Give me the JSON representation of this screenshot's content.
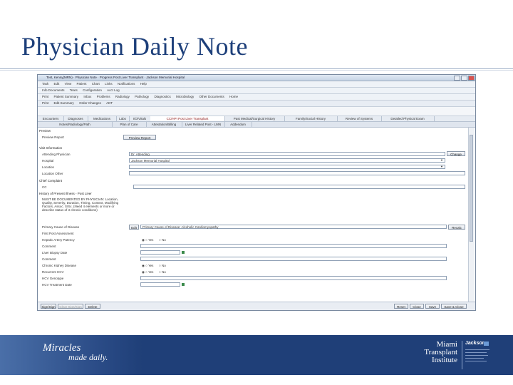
{
  "slide": {
    "title": "Physician Daily Note"
  },
  "app": {
    "window_title": "Test, Kenny(MRN) · Physician Note · Progress Post Liver Transplant · Jackson Memorial Hospital",
    "menubar": [
      "Task",
      "Edit",
      "View",
      "Patient",
      "Chart",
      "Links",
      "Notifications",
      "Help"
    ],
    "subbar": [
      "Info Documents",
      "Tears",
      "Configuration",
      "Acct Log"
    ],
    "toolbar": [
      "Print",
      "Patient Summary",
      "Inbox",
      "Problems",
      "Radiology",
      "Pathology",
      "Diagnostics",
      "Microbiology",
      "Other Documents",
      "Home"
    ],
    "toolbar2": [
      "Print",
      "Edit Summary",
      "Order Changes",
      "ADT"
    ],
    "tabs_top": [
      "Encounters",
      "Diagnoses",
      "Medications",
      "Labs",
      "I/O/Vitals",
      "CC/HPI Post Liver Transplant",
      "Past Medical/Surgical History",
      "Family/Social History",
      "Review of Systems",
      "Detailed Physical Exam"
    ],
    "tabs_bottom": [
      "Notes/Radiology/Path",
      "Plan of Care",
      "Attestation/Billing",
      "Liver Related Post - LMN",
      "Addendum"
    ],
    "sections": {
      "preview": "Preview",
      "preview_label": "Preview Report",
      "preview_button": "Preview Report",
      "visit": "Visit Information",
      "attending_label": "Attending Physician",
      "attending_value": "Dr. Attending",
      "change_button": "Change",
      "hospital_label": "Hospital",
      "hospital_value": "Jackson Memorial Hospital",
      "location_label": "Location",
      "location_other_label": "Location Other",
      "chief": "Chief Complaint",
      "cc_label": "CC",
      "hpi": "History of Present Illness - Post Liver",
      "hpi_note": "MUST BE DOCUMENTED BY PHYSICIAN: Location, Quality, Severity, Duration, Timing, Context, Modifying Factors, Assoc. S/Sx. (Need 4 elements or more or describe status of 3 chronic conditions)",
      "primary_cause_label": "Primary Cause of Disease",
      "edit_button": "Edit",
      "primary_cause_value": "Primary Cause of Disease: Alcoholic Cardiomyopathy",
      "recalc_button": "Recalc",
      "first_post_label": "First Post Assessment",
      "hepatic_label": "Hepatic Artery Patency",
      "comment1_label": "Comment",
      "liver_biopsy_label": "Liver Biopsy Date",
      "comment2_label": "Comment",
      "chronic_label": "Chronic Kidney Disease",
      "recurrent_label": "Recurrent HCV",
      "hcv_genotype_label": "HCV Genotype",
      "hcv_treatment_label": "HCV Treatment Date",
      "yes": "Yes",
      "no": "No"
    },
    "bottom_buttons": [
      "Sign/Sign",
      "Clear Sign/Sign",
      "Delete",
      "Reset",
      "Close",
      "Save",
      "Save & Close"
    ]
  },
  "footer": {
    "tagline_1": "Miracles",
    "tagline_2": "made daily.",
    "institute": [
      "Miami",
      "Transplant",
      "Institute"
    ],
    "partner": "Jackson"
  },
  "colors": {
    "title": "#1d3f7a",
    "band": "#1f3f78",
    "active_tab_text": "#8b1010"
  }
}
